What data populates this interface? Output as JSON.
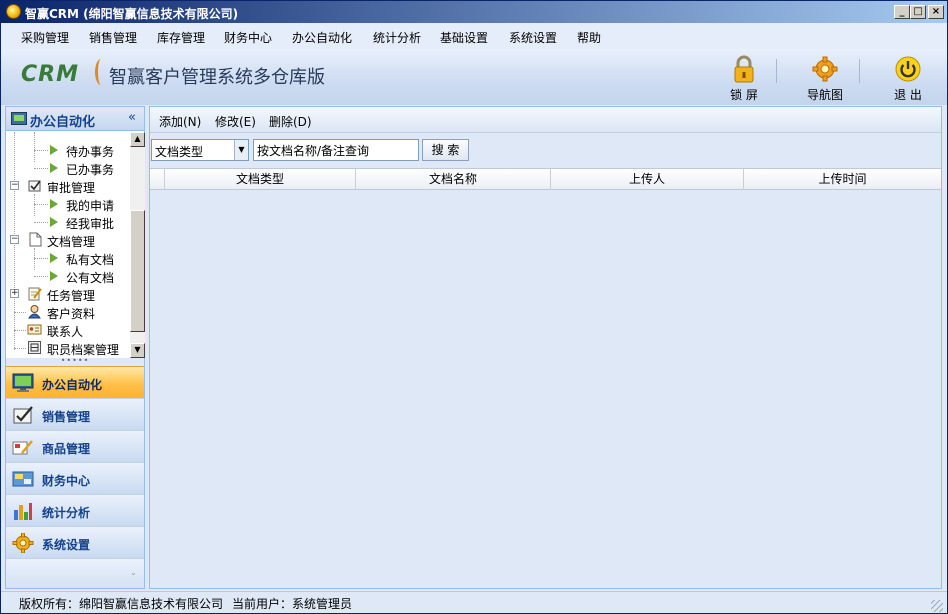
{
  "window": {
    "title": "智赢CRM (绵阳智赢信息技术有限公司)"
  },
  "menu": [
    {
      "label": "采购管理"
    },
    {
      "label": "销售管理"
    },
    {
      "label": "库存管理"
    },
    {
      "label": "财务中心"
    },
    {
      "label": "办公自动化"
    },
    {
      "label": "统计分析"
    },
    {
      "label": "基础设置"
    },
    {
      "label": "系统设置"
    },
    {
      "label": "帮助"
    }
  ],
  "banner": {
    "logo": "CRM",
    "product_name": "智赢客户管理系统多仓库版",
    "tools": [
      {
        "label": "锁 屏",
        "icon": "lock-icon"
      },
      {
        "label": "导航图",
        "icon": "gear-icon"
      },
      {
        "label": "退 出",
        "icon": "power-icon"
      }
    ]
  },
  "sidebar": {
    "title": "办公自动化",
    "collapse": "«",
    "tree": [
      {
        "label": "待办事务",
        "level": 2
      },
      {
        "label": "已办事务",
        "level": 2
      },
      {
        "label": "审批管理",
        "level": 1,
        "expanded": true,
        "icon": "approval-icon"
      },
      {
        "label": "我的申请",
        "level": 2
      },
      {
        "label": "经我审批",
        "level": 2
      },
      {
        "label": "文档管理",
        "level": 1,
        "expanded": true,
        "icon": "document-icon"
      },
      {
        "label": "私有文档",
        "level": 2
      },
      {
        "label": "公有文档",
        "level": 2
      },
      {
        "label": "任务管理",
        "level": 1,
        "expanded": false,
        "icon": "task-icon"
      },
      {
        "label": "客户资料",
        "level": 1,
        "icon": "customer-icon"
      },
      {
        "label": "联系人",
        "level": 1,
        "icon": "contact-card-icon"
      },
      {
        "label": "职员档案管理",
        "level": 1,
        "icon": "staff-file-icon"
      }
    ],
    "accordion": [
      {
        "label": "办公自动化",
        "active": true,
        "icon": "monitor-icon"
      },
      {
        "label": "销售管理",
        "active": false,
        "icon": "sales-check-icon"
      },
      {
        "label": "商品管理",
        "active": false,
        "icon": "goods-icon"
      },
      {
        "label": "财务中心",
        "active": false,
        "icon": "finance-icon"
      },
      {
        "label": "统计分析",
        "active": false,
        "icon": "bar-chart-icon"
      },
      {
        "label": "系统设置",
        "active": false,
        "icon": "settings-gear-icon"
      }
    ]
  },
  "toolbar": {
    "add": "添加(N)",
    "edit": "修改(E)",
    "delete": "删除(D)"
  },
  "filter": {
    "doc_type_value": "文档类型",
    "search_value": "按文档名称/备注查询",
    "search_button": "搜 索"
  },
  "grid": {
    "columns": [
      "文档类型",
      "文档名称",
      "上传人",
      "上传时间"
    ],
    "rows": []
  },
  "status": {
    "copyright": "版权所有：绵阳智赢信息技术有限公司",
    "current_user": "当前用户：系统管理员"
  },
  "colors": {
    "accent": "#15428b",
    "active_tab": "#ffc04a",
    "panel_bg": "#dfe8f6"
  }
}
